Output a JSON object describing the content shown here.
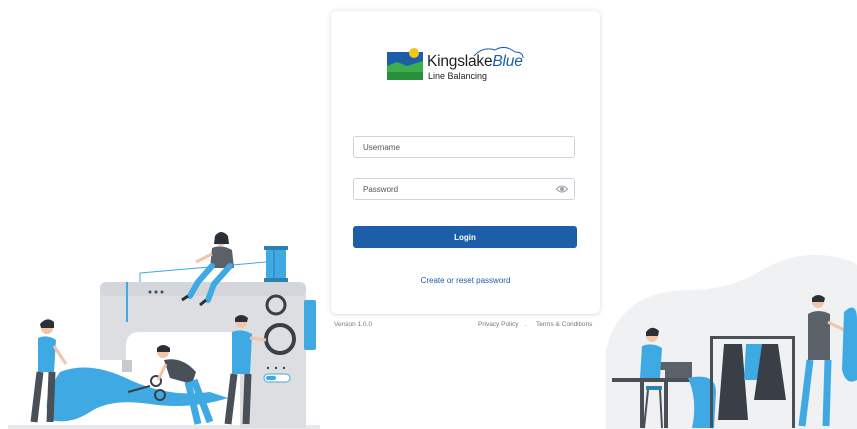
{
  "brand": {
    "name_part1": "Kingslake",
    "name_part2": "Blue",
    "tagline": "Line Balancing"
  },
  "form": {
    "username_placeholder": "Username",
    "username_value": "",
    "password_placeholder": "Password",
    "password_value": "",
    "login_label": "Login",
    "reset_link": "Create or reset password"
  },
  "footer": {
    "version": "Version 1.0.0",
    "privacy": "Privacy Policy",
    "separator": ".",
    "terms": "Terms & Conditions"
  },
  "colors": {
    "accent": "#1c5fa8",
    "illustration_blue": "#3fa9e3",
    "machine_gray": "#dcdee2"
  },
  "icons": {
    "password_toggle": "eye-icon"
  }
}
